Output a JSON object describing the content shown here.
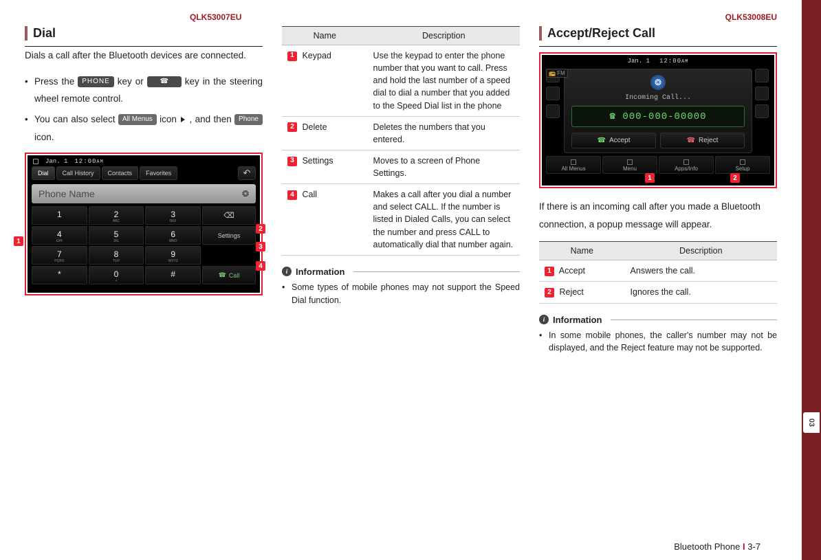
{
  "doc_codes": {
    "left": "QLK53007EU",
    "right": "QLK53008EU"
  },
  "side_tab": "03",
  "col1": {
    "title": "Dial",
    "intro": "Dials a call after the Bluetooth devices are connected.",
    "b1_pre": "Press the ",
    "b1_key1": "PHONE",
    "b1_mid": " key or ",
    "b1_post": " key in the steering wheel remote control.",
    "b2_pre": "You can also select ",
    "b2_chip1": "All Menus",
    "b2_mid1": " icon ",
    "b2_mid2": ", and then ",
    "b2_chip2": "Phone",
    "b2_post": " icon."
  },
  "dial_screen": {
    "date": "Jan. 1",
    "time": "12:00",
    "ampm": "AM",
    "tabs": [
      "Dial",
      "Call History",
      "Contacts",
      "Favorites"
    ],
    "name_placeholder": "Phone Name",
    "keys": [
      [
        "1",
        "",
        "2",
        "ABC",
        "3",
        "DEF"
      ],
      [
        "4",
        "GHI",
        "5",
        "JKL",
        "6",
        "MNO"
      ],
      [
        "7",
        "PQRS",
        "8",
        "TUV",
        "9",
        "WXYZ"
      ],
      [
        "*",
        "",
        "0",
        "+",
        "#",
        ""
      ]
    ],
    "side_del": "⌫",
    "side_settings": "Settings",
    "side_call": "Call"
  },
  "table1": {
    "h1": "Name",
    "h2": "Description",
    "rows": [
      {
        "n": "1",
        "name": "Keypad",
        "desc": "Use the keypad to enter the phone number that you want to call. Press and hold the last number of a speed dial to dial a number that you added to the Speed Dial list in the phone"
      },
      {
        "n": "2",
        "name": "Delete",
        "desc": "Deletes the numbers that you entered."
      },
      {
        "n": "3",
        "name": "Settings",
        "desc": "Moves to a screen of Phone Settings."
      },
      {
        "n": "4",
        "name": "Call",
        "desc": "Makes a call after you dial a number and select CALL. If the number is listed in Dialed Calls, you can select the number and press CALL to automatically dial that number again."
      }
    ]
  },
  "info1": {
    "title": "Information",
    "item": "Some types of mobile phones may not support the Speed Dial function."
  },
  "col3": {
    "title": "Accept/Reject Call",
    "intro": "If there is an incoming call after you made a Bluetooth connection, a popup message will appear."
  },
  "incoming_screen": {
    "date": "Jan. 1",
    "time": "12:00",
    "ampm": "AM",
    "fm": "FM",
    "label": "Incoming Call...",
    "number": "000-000-00000",
    "accept": "Accept",
    "reject": "Reject",
    "bottom": [
      "All Menus",
      "Menu",
      "Apps/Info",
      "Setup"
    ]
  },
  "table2": {
    "h1": "Name",
    "h2": "Description",
    "rows": [
      {
        "n": "1",
        "name": "Accept",
        "desc": "Answers the call."
      },
      {
        "n": "2",
        "name": "Reject",
        "desc": "Ignores the call."
      }
    ]
  },
  "info2": {
    "title": "Information",
    "item": "In some mobile phones, the caller's number may not be displayed, and the Reject feature may not be supported."
  },
  "footer": {
    "section": "Bluetooth Phone",
    "page": "3-7"
  }
}
